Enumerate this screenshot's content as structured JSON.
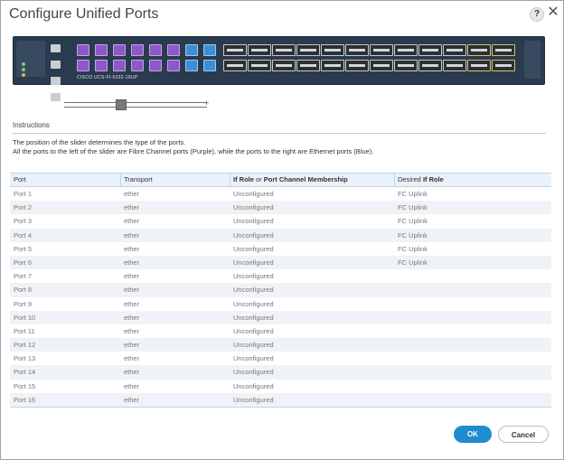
{
  "dialog": {
    "title": "Configure Unified Ports",
    "help_label": "?",
    "close_label": "✕"
  },
  "switch": {
    "model_label": "CISCO UCS-FI-6332-16UP"
  },
  "slider": {
    "end_mark": "+",
    "fc_port_count": 6
  },
  "instructions": {
    "heading": "Instructions",
    "line1": "The position of the slider determines the type of the ports.",
    "line2": "All the ports to the left of the slider are Fibre Channel ports (Purple), while the ports to the right are Ethernet ports (Blue)."
  },
  "table": {
    "headers": {
      "port": "Port",
      "transport": "Transport",
      "if_role_a": "If Role",
      "if_role_or": " or ",
      "if_role_b": "Port Channel Membership",
      "desired_a": "Desired ",
      "desired_b": "If Role"
    },
    "rows": [
      {
        "port": "Port 1",
        "transport": "ether",
        "role": "Unconfigured",
        "desired": "FC Uplink"
      },
      {
        "port": "Port 2",
        "transport": "ether",
        "role": "Unconfigured",
        "desired": "FC Uplink"
      },
      {
        "port": "Port 3",
        "transport": "ether",
        "role": "Unconfigured",
        "desired": "FC Uplink"
      },
      {
        "port": "Port 4",
        "transport": "ether",
        "role": "Unconfigured",
        "desired": "FC Uplink"
      },
      {
        "port": "Port 5",
        "transport": "ether",
        "role": "Unconfigured",
        "desired": "FC Uplink"
      },
      {
        "port": "Port 6",
        "transport": "ether",
        "role": "Unconfigured",
        "desired": "FC Uplink"
      },
      {
        "port": "Port 7",
        "transport": "ether",
        "role": "Unconfigured",
        "desired": ""
      },
      {
        "port": "Port 8",
        "transport": "ether",
        "role": "Unconfigured",
        "desired": ""
      },
      {
        "port": "Port 9",
        "transport": "ether",
        "role": "Unconfigured",
        "desired": ""
      },
      {
        "port": "Port 10",
        "transport": "ether",
        "role": "Unconfigured",
        "desired": ""
      },
      {
        "port": "Port 11",
        "transport": "ether",
        "role": "Unconfigured",
        "desired": ""
      },
      {
        "port": "Port 12",
        "transport": "ether",
        "role": "Unconfigured",
        "desired": ""
      },
      {
        "port": "Port 13",
        "transport": "ether",
        "role": "Unconfigured",
        "desired": ""
      },
      {
        "port": "Port 14",
        "transport": "ether",
        "role": "Unconfigured",
        "desired": ""
      },
      {
        "port": "Port 15",
        "transport": "ether",
        "role": "Unconfigured",
        "desired": ""
      },
      {
        "port": "Port 16",
        "transport": "ether",
        "role": "Unconfigured",
        "desired": ""
      }
    ]
  },
  "buttons": {
    "ok": "OK",
    "cancel": "Cancel"
  },
  "colors": {
    "fc_port": "#8e58c8",
    "ethernet_port": "#3c8fd6",
    "primary": "#1f8ccf"
  }
}
